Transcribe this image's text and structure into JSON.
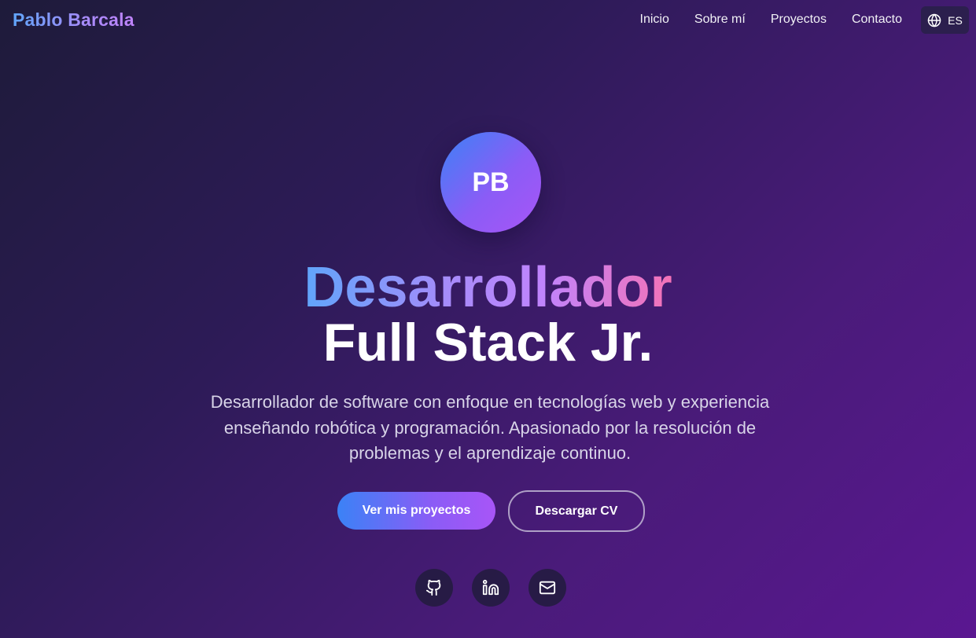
{
  "nav": {
    "brand": "Pablo Barcala",
    "links": [
      {
        "label": "Inicio"
      },
      {
        "label": "Sobre mí"
      },
      {
        "label": "Proyectos"
      },
      {
        "label": "Contacto"
      }
    ],
    "language": {
      "label": "ES",
      "icon": "globe-icon"
    }
  },
  "hero": {
    "avatar_initials": "PB",
    "title_line1": "Desarrollador",
    "title_line2": "Full Stack Jr.",
    "description": "Desarrollador de software con enfoque en tecnologías web y experiencia enseñando robótica y programación. Apasionado por la resolución de problemas y el aprendizaje continuo.",
    "primary_button": "Ver mis proyectos",
    "secondary_button": "Descargar CV"
  },
  "socials": [
    {
      "icon": "github-icon"
    },
    {
      "icon": "linkedin-icon"
    },
    {
      "icon": "mail-icon"
    }
  ],
  "colors": {
    "accent_blue": "#3b82f6",
    "accent_purple": "#a855f7",
    "accent_pink": "#f472b6",
    "background_dark": "#1e1b3a",
    "background_purple": "#5a1791"
  }
}
